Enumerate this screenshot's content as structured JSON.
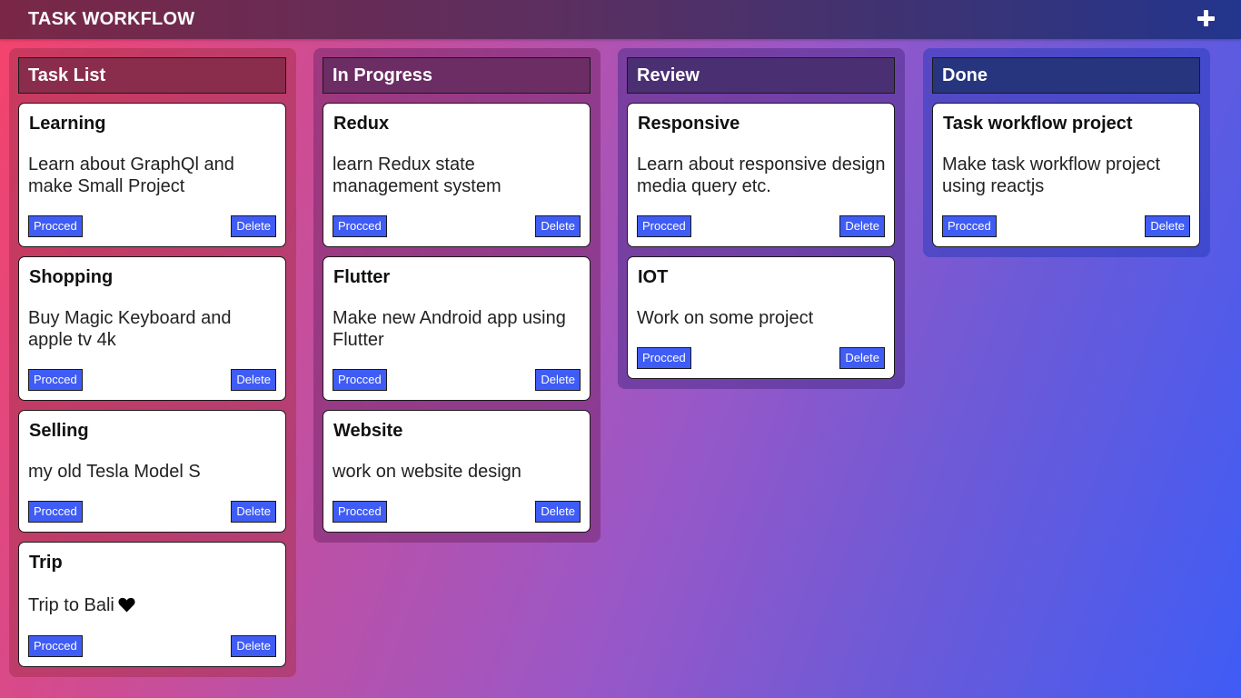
{
  "app": {
    "title": "TASK WORKFLOW",
    "add_icon": "plus-icon"
  },
  "colors": {
    "button": "#3f5cf5",
    "background_start": "#f5436b",
    "background_end": "#3f5cf5"
  },
  "buttons": {
    "proceed": "Procced",
    "delete": "Delete"
  },
  "columns": [
    {
      "title": "Task List",
      "cards": [
        {
          "title": "Learning",
          "description": "Learn about GraphQl and make Small Project"
        },
        {
          "title": "Shopping",
          "description": "Buy Magic Keyboard and apple tv 4k"
        },
        {
          "title": "Selling",
          "description": "my old Tesla Model S"
        },
        {
          "title": "Trip",
          "description": "Trip to Bali",
          "icon": "heart-icon"
        }
      ]
    },
    {
      "title": "In Progress",
      "cards": [
        {
          "title": "Redux",
          "description": "learn Redux state management system"
        },
        {
          "title": "Flutter",
          "description": "Make new Android app using Flutter"
        },
        {
          "title": "Website",
          "description": "work on website design"
        }
      ]
    },
    {
      "title": "Review",
      "cards": [
        {
          "title": "Responsive",
          "description": "Learn about responsive design media query etc."
        },
        {
          "title": "IOT",
          "description": "Work on some project"
        }
      ]
    },
    {
      "title": "Done",
      "cards": [
        {
          "title": "Task workflow project",
          "description": "Make task workflow project using reactjs"
        }
      ]
    }
  ]
}
